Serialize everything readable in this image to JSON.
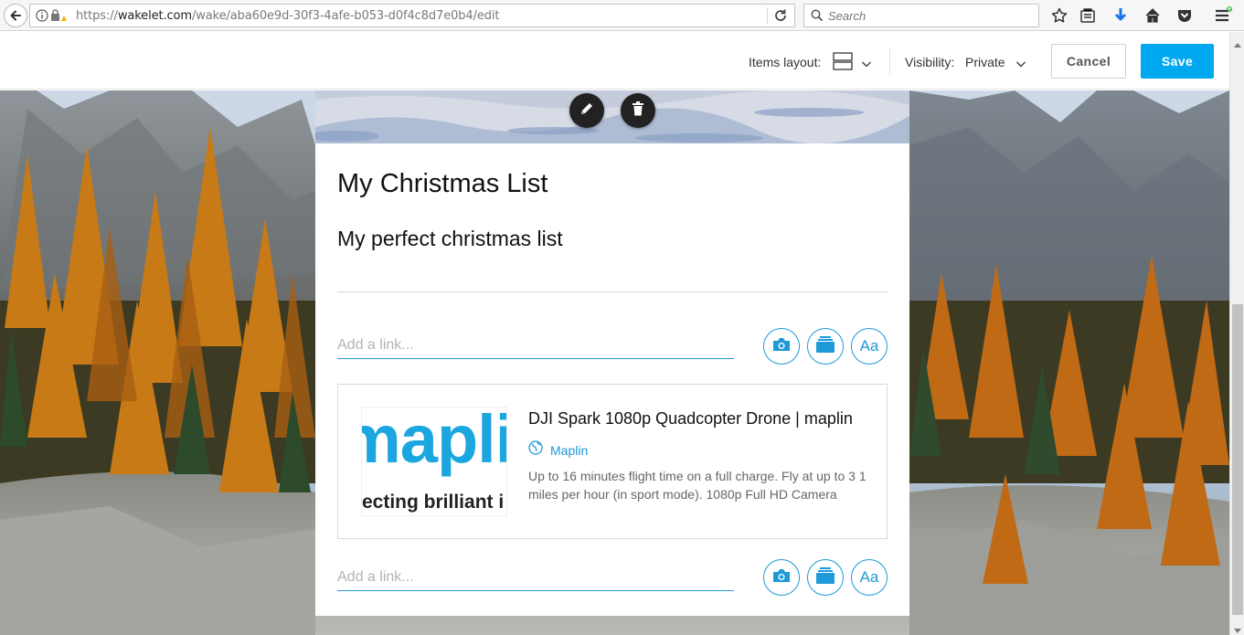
{
  "browser": {
    "url_prefix": "https://",
    "url_domain": "wakelet.com",
    "url_path": "/wake/aba60e9d-30f3-4afe-b053-d0f4c8d7e0b4/edit",
    "search_placeholder": "Search"
  },
  "toolbar": {
    "items_layout_label": "Items layout:",
    "visibility_label": "Visibility:",
    "visibility_value": "Private",
    "cancel_label": "Cancel",
    "save_label": "Save"
  },
  "wake": {
    "title": "My Christmas List",
    "description": "My perfect christmas list",
    "add_link_placeholder": "Add a link...",
    "add_text_label": "Aa"
  },
  "item": {
    "title": "DJI Spark 1080p Quadcopter Drone | maplin",
    "source": "Maplin",
    "description": "Up to 16 minutes flight time on a full charge. Fly at up to 3 1 miles per hour (in sport mode). 1080p Full HD Camera",
    "thumb_logo_text": "mapli",
    "thumb_tagline": "ecting brilliant i"
  },
  "colors": {
    "accent": "#1e9ad8",
    "save_button": "#00a8f0"
  }
}
